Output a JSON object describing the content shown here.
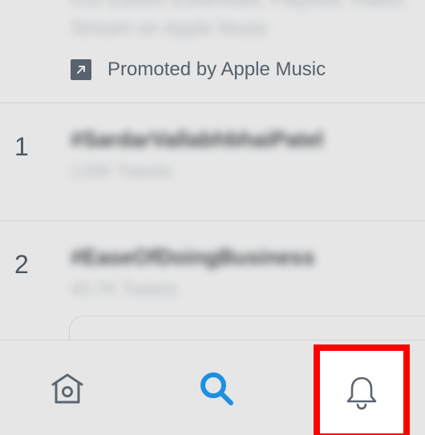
{
  "promoted": {
    "line1": "iOS Edition Essentials. Playlists. Radio.",
    "line2": "Stream on Apple Music",
    "label": "Promoted by Apple Music",
    "icon": "external-arrow-icon"
  },
  "trends": [
    {
      "rank": "1",
      "tag": "#SardarVallabhbhaiPatel",
      "count": "133K Tweets"
    },
    {
      "rank": "2",
      "tag": "#EaseOfDoingBusiness",
      "count": "40.7K Tweets"
    }
  ],
  "bottom_nav": {
    "home_icon": "home-icon",
    "search_icon": "search-icon",
    "notifications_icon": "bell-icon"
  },
  "colors": {
    "background": "#e6e6e6",
    "accent": "#1d8fe0",
    "highlight": "#ff0000",
    "icon": "#5b6670"
  }
}
